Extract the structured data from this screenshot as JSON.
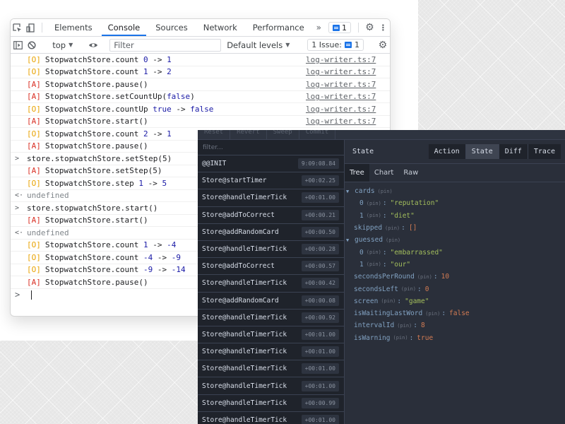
{
  "devtools": {
    "tabs": [
      {
        "label": "Elements",
        "active": false
      },
      {
        "label": "Console",
        "active": true
      },
      {
        "label": "Sources",
        "active": false
      },
      {
        "label": "Network",
        "active": false
      },
      {
        "label": "Performance",
        "active": false
      }
    ],
    "more_tabs_icon": "»",
    "issue_count_badge": "1",
    "toolbar": {
      "context": "top",
      "filter_placeholder": "Filter",
      "levels": "Default levels",
      "issues_label": "1 Issue:",
      "issues_count": "1"
    },
    "console_lines": [
      {
        "kind": "log",
        "tag": "[O]",
        "tagType": "o",
        "text": "StopwatchStore.count ",
        "parts": [
          {
            "t": "0",
            "c": "num"
          },
          {
            "t": " -> ",
            "c": "txt"
          },
          {
            "t": "1",
            "c": "num"
          }
        ],
        "source": "log-writer.ts:7"
      },
      {
        "kind": "log",
        "tag": "[O]",
        "tagType": "o",
        "text": "StopwatchStore.count ",
        "parts": [
          {
            "t": "1",
            "c": "num"
          },
          {
            "t": " -> ",
            "c": "txt"
          },
          {
            "t": "2",
            "c": "num"
          }
        ],
        "source": "log-writer.ts:7"
      },
      {
        "kind": "log",
        "tag": "[A]",
        "tagType": "a",
        "text": "StopwatchStore.pause()",
        "parts": [],
        "source": "log-writer.ts:7"
      },
      {
        "kind": "log",
        "tag": "[A]",
        "tagType": "a",
        "text": "StopwatchStore.setCountUp(",
        "parts": [
          {
            "t": "false",
            "c": "num"
          },
          {
            "t": ")",
            "c": "txt"
          }
        ],
        "source": "log-writer.ts:7"
      },
      {
        "kind": "log",
        "tag": "[O]",
        "tagType": "o",
        "text": "StopwatchStore.countUp ",
        "parts": [
          {
            "t": "true",
            "c": "num"
          },
          {
            "t": " -> ",
            "c": "txt"
          },
          {
            "t": "false",
            "c": "num"
          }
        ],
        "source": "log-writer.ts:7"
      },
      {
        "kind": "log",
        "tag": "[A]",
        "tagType": "a",
        "text": "StopwatchStore.start()",
        "parts": [],
        "source": "log-writer.ts:7"
      },
      {
        "kind": "log",
        "tag": "[O]",
        "tagType": "o",
        "text": "StopwatchStore.count ",
        "parts": [
          {
            "t": "2",
            "c": "num"
          },
          {
            "t": " -> ",
            "c": "txt"
          },
          {
            "t": "1",
            "c": "num"
          }
        ],
        "source": ""
      },
      {
        "kind": "log",
        "tag": "[A]",
        "tagType": "a",
        "text": "StopwatchStore.pause()",
        "parts": [],
        "source": ""
      },
      {
        "kind": "input",
        "text": "store.stopwatchStore.setStep(5)"
      },
      {
        "kind": "log",
        "tag": "[A]",
        "tagType": "a",
        "text": "StopwatchStore.setStep(5)",
        "parts": [],
        "source": ""
      },
      {
        "kind": "log",
        "tag": "[O]",
        "tagType": "o",
        "text": "StopwatchStore.step ",
        "parts": [
          {
            "t": "1",
            "c": "num"
          },
          {
            "t": " -> ",
            "c": "txt"
          },
          {
            "t": "5",
            "c": "num"
          }
        ],
        "source": ""
      },
      {
        "kind": "result",
        "text": "undefined"
      },
      {
        "kind": "input",
        "text": "store.stopwatchStore.start()"
      },
      {
        "kind": "log",
        "tag": "[A]",
        "tagType": "a",
        "text": "StopwatchStore.start()",
        "parts": [],
        "source": ""
      },
      {
        "kind": "result",
        "text": "undefined"
      },
      {
        "kind": "log",
        "tag": "[O]",
        "tagType": "o",
        "text": "StopwatchStore.count ",
        "parts": [
          {
            "t": "1",
            "c": "num"
          },
          {
            "t": " -> ",
            "c": "txt"
          },
          {
            "t": "-4",
            "c": "num"
          }
        ],
        "source": ""
      },
      {
        "kind": "log",
        "tag": "[O]",
        "tagType": "o",
        "text": "StopwatchStore.count ",
        "parts": [
          {
            "t": "-4",
            "c": "num"
          },
          {
            "t": " -> ",
            "c": "txt"
          },
          {
            "t": "-9",
            "c": "num"
          }
        ],
        "source": ""
      },
      {
        "kind": "log",
        "tag": "[O]",
        "tagType": "o",
        "text": "StopwatchStore.count ",
        "parts": [
          {
            "t": "-9",
            "c": "num"
          },
          {
            "t": " -> ",
            "c": "txt"
          },
          {
            "t": "-14",
            "c": "num"
          }
        ],
        "source": ""
      },
      {
        "kind": "log",
        "tag": "[A]",
        "tagType": "a",
        "text": "StopwatchStore.pause()",
        "parts": [],
        "source": ""
      }
    ],
    "input_prompt": ">",
    "result_prompt": "<·",
    "input_caret": ">"
  },
  "redux": {
    "top_buttons": [
      "Reset",
      "Revert",
      "Sweep",
      "Commit"
    ],
    "filter_placeholder": "filter...",
    "actions": [
      {
        "name": "@@INIT",
        "time": "9:09:08.84"
      },
      {
        "name": "Store@startTimer",
        "time": "+00:02.25"
      },
      {
        "name": "Store@handleTimerTick",
        "time": "+00:01.00"
      },
      {
        "name": "Store@addToCorrect",
        "time": "+00:00.21"
      },
      {
        "name": "Store@addRandomCard",
        "time": "+00:00.50"
      },
      {
        "name": "Store@handleTimerTick",
        "time": "+00:00.28"
      },
      {
        "name": "Store@addToCorrect",
        "time": "+00:00.57"
      },
      {
        "name": "Store@handleTimerTick",
        "time": "+00:00.42"
      },
      {
        "name": "Store@addRandomCard",
        "time": "+00:00.08"
      },
      {
        "name": "Store@handleTimerTick",
        "time": "+00:00.92"
      },
      {
        "name": "Store@handleTimerTick",
        "time": "+00:01.00"
      },
      {
        "name": "Store@handleTimerTick",
        "time": "+00:01.00"
      },
      {
        "name": "Store@handleTimerTick",
        "time": "+00:01.00"
      },
      {
        "name": "Store@handleTimerTick",
        "time": "+00:01.00"
      },
      {
        "name": "Store@handleTimerTick",
        "time": "+00:00.99"
      },
      {
        "name": "Store@handleTimerTick",
        "time": "+00:01.00"
      }
    ],
    "panel_title": "State",
    "view_buttons": [
      {
        "label": "Action",
        "active": false
      },
      {
        "label": "State",
        "active": true
      },
      {
        "label": "Diff",
        "active": false
      },
      {
        "label": "Trace",
        "active": false
      }
    ],
    "subtabs": [
      {
        "label": "Tree",
        "active": true
      },
      {
        "label": "Chart",
        "active": false
      },
      {
        "label": "Raw",
        "active": false
      }
    ],
    "pin_label": "(pin)",
    "tree": [
      {
        "indent": 0,
        "expand": true,
        "key": "cards",
        "value": null,
        "type": ""
      },
      {
        "indent": 2,
        "expand": false,
        "key": "0",
        "value": "\"reputation\"",
        "type": "str"
      },
      {
        "indent": 2,
        "expand": false,
        "key": "1",
        "value": "\"diet\"",
        "type": "str"
      },
      {
        "indent": 1,
        "expand": false,
        "key": "skipped",
        "value": "[]",
        "type": "arr"
      },
      {
        "indent": 0,
        "expand": true,
        "key": "guessed",
        "value": null,
        "type": ""
      },
      {
        "indent": 2,
        "expand": false,
        "key": "0",
        "value": "\"embarrassed\"",
        "type": "str"
      },
      {
        "indent": 2,
        "expand": false,
        "key": "1",
        "value": "\"our\"",
        "type": "str"
      },
      {
        "indent": 1,
        "expand": false,
        "key": "secondsPerRound",
        "value": "10",
        "type": "num"
      },
      {
        "indent": 1,
        "expand": false,
        "key": "secondsLeft",
        "value": "0",
        "type": "num"
      },
      {
        "indent": 1,
        "expand": false,
        "key": "screen",
        "value": "\"game\"",
        "type": "str"
      },
      {
        "indent": 1,
        "expand": false,
        "key": "isWaitingLastWord",
        "value": "false",
        "type": "num"
      },
      {
        "indent": 1,
        "expand": false,
        "key": "intervalId",
        "value": "8",
        "type": "num"
      },
      {
        "indent": 1,
        "expand": false,
        "key": "isWarning",
        "value": "true",
        "type": "num"
      }
    ]
  }
}
